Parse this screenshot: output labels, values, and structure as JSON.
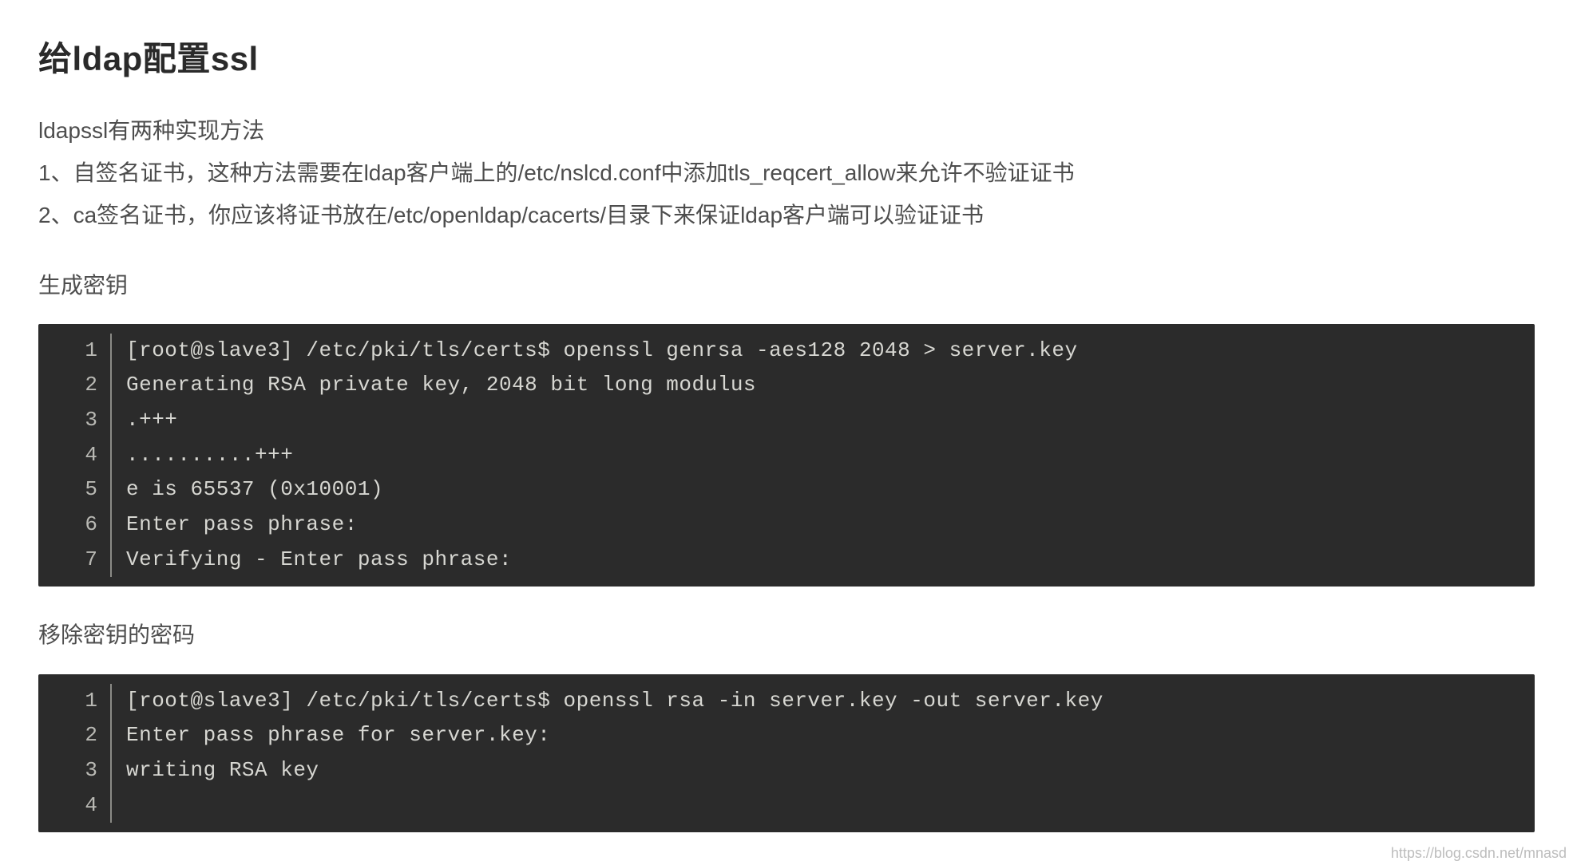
{
  "section": {
    "title": "给ldap配置ssl",
    "intro": "ldapssl有两种实现方法",
    "method1": "1、自签名证书，这种方法需要在ldap客户端上的/etc/nslcd.conf中添加tls_reqcert_allow来允许不验证证书",
    "method2": "2、ca签名证书，你应该将证书放在/etc/openldap/cacerts/目录下来保证ldap客户端可以验证证书",
    "gen_key_label": "生成密钥",
    "remove_pw_label": "移除密钥的密码"
  },
  "code_blocks": {
    "gen_key": [
      "[root@slave3] /etc/pki/tls/certs$ openssl genrsa -aes128 2048 > server.key",
      "Generating RSA private key, 2048 bit long modulus",
      ".+++",
      "..........+++",
      "e is 65537 (0x10001)",
      "Enter pass phrase:",
      "Verifying - Enter pass phrase:"
    ],
    "remove_pw": [
      "[root@slave3] /etc/pki/tls/certs$ openssl rsa -in server.key -out server.key",
      "Enter pass phrase for server.key:",
      "writing RSA key",
      ""
    ]
  },
  "watermark": "https://blog.csdn.net/mnasd"
}
